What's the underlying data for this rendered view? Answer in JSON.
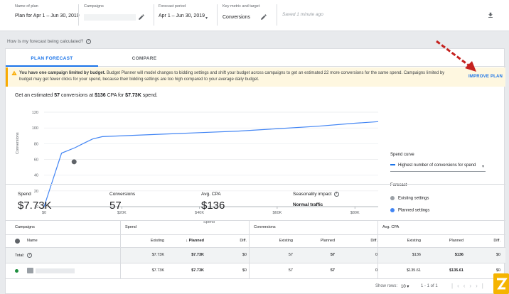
{
  "header": {
    "plan_name_label": "Name of plan",
    "plan_name_value": "Plan for Apr 1 – Jun 30, 2019",
    "campaigns_label": "Campaigns",
    "forecast_period_label": "Forecast period",
    "forecast_period_value": "Apr 1 – Jun 30, 2019",
    "key_metric_label": "Key metric and target",
    "key_metric_value": "Conversions",
    "saved_text": "Saved 1 minute ago"
  },
  "help": {
    "text": "How is my forecast being calculated?"
  },
  "tabs": [
    {
      "label": "PLAN FORECAST",
      "active": true
    },
    {
      "label": "COMPARE",
      "active": false
    }
  ],
  "banner": {
    "bold": "You have one campaign limited by budget.",
    "text": " Budget Planner will model changes to bidding settings and shift your budget across campaigns to get an estimated 22 more conversions for the same spend. Campaigns limited by budget may get fewer clicks for your spend, because their bidding settings are too high compared to your average daily budget.",
    "action": "IMPROVE PLAN"
  },
  "estimate": {
    "p1": "Get an estimated ",
    "conversions": "57",
    "p2": " conversions at ",
    "cpa": "$136",
    "p3": " CPA for ",
    "spend": "$7.73K",
    "p4": " spend."
  },
  "chart_data": {
    "type": "line",
    "xlabel": "Spend",
    "ylabel": "Conversions",
    "x_ticks": [
      "$0",
      "$20K",
      "$40K",
      "$60K",
      "$80K"
    ],
    "y_ticks": [
      "0",
      "20",
      "40",
      "60",
      "80",
      "100",
      "120"
    ],
    "xlim": [
      0,
      86000
    ],
    "ylim": [
      0,
      120
    ],
    "series": [
      {
        "name": "Planned settings",
        "color": "#4285f4",
        "x": [
          0,
          4500,
          8000,
          10000,
          12500,
          15000,
          20000,
          30000,
          40000,
          50000,
          60000,
          70000,
          80000,
          86000
        ],
        "y": [
          0,
          68,
          75,
          80,
          86,
          89,
          90,
          92,
          94,
          96,
          99,
          102,
          106,
          108
        ]
      }
    ],
    "points": [
      {
        "name": "Existing settings",
        "x": 7730,
        "y": 57,
        "color": "#5f6368"
      }
    ],
    "grid": true
  },
  "spend_curve": {
    "label": "Spend curve",
    "option": "Highest number of conversions for spend"
  },
  "forecast_legend": {
    "label": "Forecast",
    "existing": "Existing settings",
    "planned": "Planned settings",
    "existing_color": "#9aa0a6",
    "planned_color": "#4285f4"
  },
  "metrics": {
    "spend_label": "Spend",
    "spend_value": "$7.73K",
    "conversions_label": "Conversions",
    "conversions_value": "57",
    "cpa_label": "Avg. CPA",
    "cpa_value": "$136",
    "seasonality_label": "Seasonality impact",
    "seasonality_value": "Normal traffic"
  },
  "table": {
    "group_headers": [
      "Campaigns",
      "Spend",
      "Conversions",
      "Avg. CPA"
    ],
    "name_header": "Name",
    "sub_headers": [
      "Existing",
      "Planned",
      "Diff."
    ],
    "total_label": "Total:",
    "rows": [
      {
        "spend": [
          "$7.73K",
          "$7.73K",
          "$0"
        ],
        "conv": [
          "57",
          "57",
          "0"
        ],
        "cpa": [
          "$136",
          "$136",
          "$0"
        ]
      },
      {
        "spend": [
          "$7.73K",
          "$7.73K",
          "$0"
        ],
        "conv": [
          "57",
          "57",
          "0"
        ],
        "cpa": [
          "$135.61",
          "$135.61",
          "$0"
        ]
      }
    ]
  },
  "pagination": {
    "show_rows_label": "Show rows:",
    "rows_value": "10",
    "range": "1 - 1 of 1"
  }
}
